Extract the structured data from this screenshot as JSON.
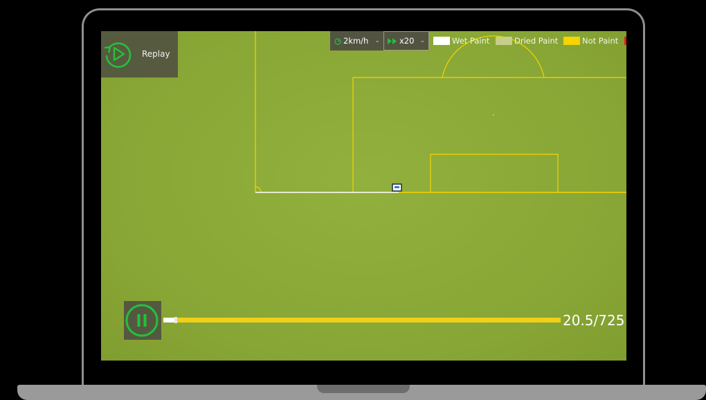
{
  "replay": {
    "label": "Replay",
    "icon": "replay-icon"
  },
  "controls": {
    "speed": {
      "value": "2km/h",
      "icon": "speed-gauge-icon"
    },
    "multiplier": {
      "value": "x20",
      "icon": "fast-forward-icon"
    }
  },
  "legend": [
    {
      "label": "Wet Paint",
      "color": "#ffffff"
    },
    {
      "label": "Dried Paint",
      "color": "#c6cf8a"
    },
    {
      "label": "Not Paint",
      "color": "#f5d400"
    }
  ],
  "legend_overflow_color": "#e02020",
  "playback": {
    "state_icon": "pause-icon",
    "progress_text": "20.5/725",
    "progress_fraction": 0.0283
  },
  "colors": {
    "accent_green": "#22c23a",
    "field_green": "#8aa836",
    "line_yellow": "#f5d400",
    "panel": "#505041"
  }
}
